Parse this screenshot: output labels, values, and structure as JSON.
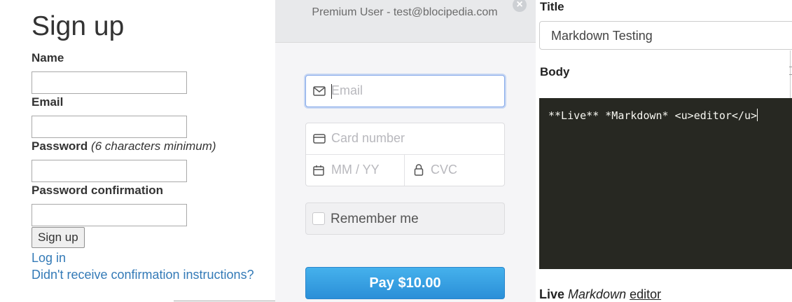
{
  "signup": {
    "title": "Sign up",
    "name_label": "Name",
    "email_label": "Email",
    "password_label": "Password",
    "password_hint": "(6 characters minimum)",
    "password_confirmation_label": "Password confirmation",
    "submit_label": "Sign up",
    "login_link": "Log in",
    "confirmation_link": "Didn't receive confirmation instructions?"
  },
  "checkout": {
    "user_line": "Premium User - test@blocipedia.com",
    "close_icon": "close-icon",
    "email_placeholder": "Email",
    "card_number_placeholder": "Card number",
    "expiry_placeholder": "MM / YY",
    "cvc_placeholder": "CVC",
    "remember_label": "Remember me",
    "pay_label": "Pay $10.00",
    "accent_color": "#2b8fd8"
  },
  "editor": {
    "title_label": "Title",
    "title_value": "Markdown Testing",
    "body_label": "Body",
    "body_code": "**Live** *Markdown* <u>editor</u>",
    "preview": {
      "bold": "Live",
      "italic": "Markdown",
      "underline": "editor"
    },
    "editor_bg": "#272822"
  }
}
